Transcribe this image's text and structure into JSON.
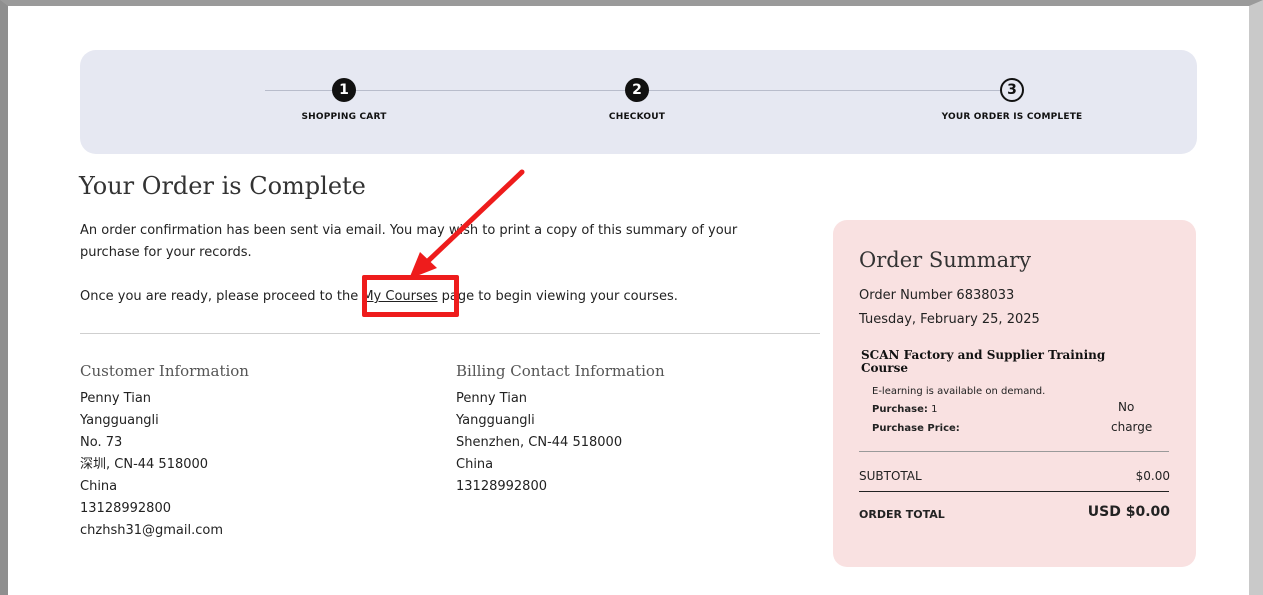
{
  "steps": [
    {
      "num": "1",
      "label": "SHOPPING CART"
    },
    {
      "num": "2",
      "label": "CHECKOUT"
    },
    {
      "num": "3",
      "label": "YOUR ORDER IS COMPLETE"
    }
  ],
  "title": "Your Order is Complete",
  "confirmation_text": "An order confirmation has been sent via email. You may wish to print a copy of this summary of your purchase for your records.",
  "proceed_before": "Once you are ready, please proceed to the ",
  "proceed_link": "My Courses",
  "proceed_after": " page to begin viewing your courses.",
  "customer": {
    "heading": "Customer Information",
    "lines": [
      "Penny Tian",
      "Yangguangli",
      "No. 73",
      "深圳, CN-44 518000",
      "China",
      "13128992800",
      "chzhsh31@gmail.com"
    ]
  },
  "billing": {
    "heading": "Billing Contact Information",
    "lines": [
      "Penny Tian",
      "Yangguangli",
      "Shenzhen, CN-44 518000",
      "China",
      "13128992800"
    ]
  },
  "summary": {
    "heading": "Order Summary",
    "order_number": "Order Number 6838033",
    "date": "Tuesday, February 25, 2025",
    "course_name": "SCAN Factory and Supplier Training Course",
    "availability": "E-learning is available on demand.",
    "purchase_label": "Purchase:",
    "purchase_qty": "1",
    "price_label": "Purchase Price:",
    "price_value_1": "No",
    "price_value_2": "charge",
    "subtotal_label": "SUBTOTAL",
    "subtotal_value": "$0.00",
    "total_label": "ORDER TOTAL",
    "total_value": "USD $0.00"
  },
  "colors": {
    "annotation": "#ee1c1c",
    "steps_bg": "#e6e8f2",
    "summary_bg": "#f9e1e1"
  }
}
